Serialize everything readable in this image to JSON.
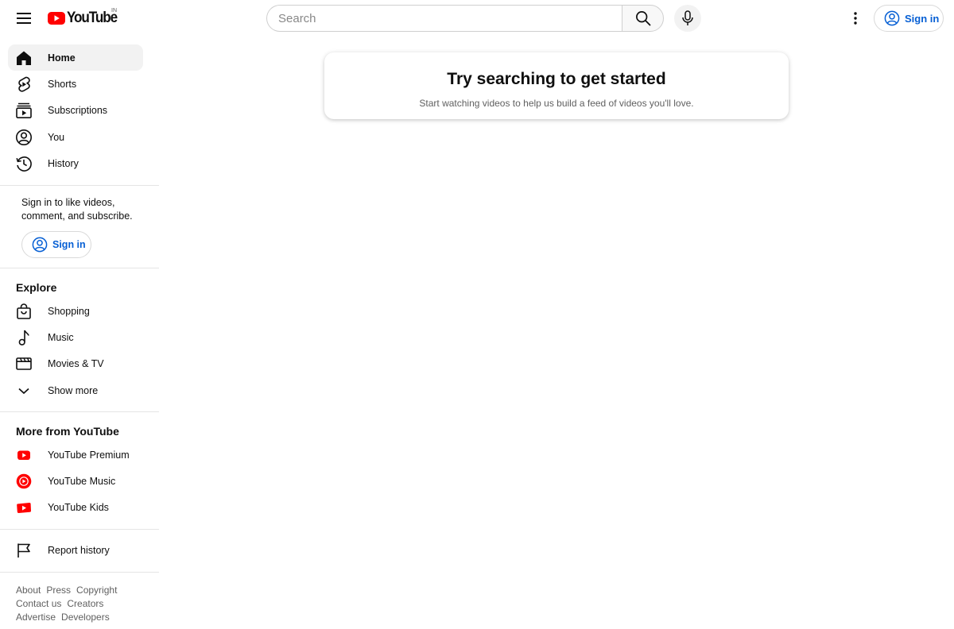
{
  "header": {
    "logo_text": "YouTube",
    "country_code": "IN",
    "search": {
      "placeholder": "Search",
      "value": ""
    },
    "sign_in_label": "Sign in"
  },
  "sidebar": {
    "primary": [
      {
        "label": "Home",
        "icon": "home-icon",
        "active": true
      },
      {
        "label": "Shorts",
        "icon": "shorts-icon"
      },
      {
        "label": "Subscriptions",
        "icon": "subscriptions-icon"
      },
      {
        "label": "You",
        "icon": "you-icon"
      },
      {
        "label": "History",
        "icon": "history-icon"
      }
    ],
    "sign_in_prompt": "Sign in to like videos, comment, and subscribe.",
    "sign_in_label": "Sign in",
    "explore": {
      "title": "Explore",
      "items": [
        {
          "label": "Shopping",
          "icon": "shopping-bag-icon"
        },
        {
          "label": "Music",
          "icon": "music-note-icon"
        },
        {
          "label": "Movies & TV",
          "icon": "movies-icon"
        },
        {
          "label": "Show more",
          "icon": "chevron-down-icon"
        }
      ]
    },
    "more_from": {
      "title": "More from YouTube",
      "items": [
        {
          "label": "YouTube Premium",
          "icon": "youtube-premium-icon"
        },
        {
          "label": "YouTube Music",
          "icon": "youtube-music-icon"
        },
        {
          "label": "YouTube Kids",
          "icon": "youtube-kids-icon"
        }
      ]
    },
    "report_history": {
      "label": "Report history",
      "icon": "flag-icon"
    },
    "footer": {
      "row1": [
        "About",
        "Press",
        "Copyright"
      ],
      "row2": [
        "Contact us",
        "Creators"
      ],
      "row3": [
        "Advertise",
        "Developers"
      ]
    }
  },
  "main": {
    "title": "Try searching to get started",
    "subtitle": "Start watching videos to help us build a feed of videos you'll love."
  },
  "colors": {
    "brand_red": "#ff0000",
    "link_blue": "#065fd4",
    "active_bg": "#f2f2f2",
    "divider": "#e5e5e5",
    "secondary_text": "#606060"
  }
}
